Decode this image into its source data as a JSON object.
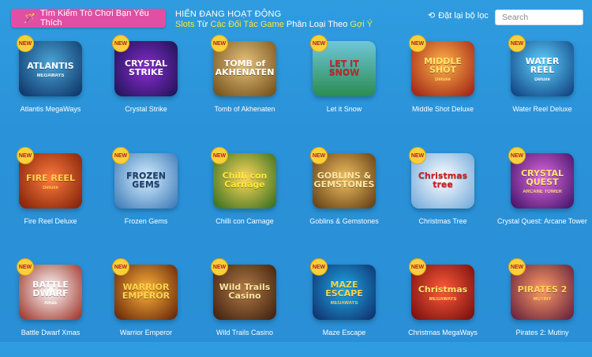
{
  "header": {
    "find_button_label": "Tìm Kiếm Trò Chơi Bạn Yêu Thích",
    "filter_line1": "HIỂN ĐANG HOẠT ĐỘNG",
    "filter_line2": {
      "slots": "Slots",
      "tu": "Từ",
      "partners": "Các Đối Tác Game",
      "sort_by": "Phân Loại Theo",
      "suggested": "Gợi Ý"
    },
    "reset_label": "Đặt lại bộ lọc",
    "search_placeholder": "Search"
  },
  "badge_label": "NEW",
  "games": [
    {
      "title": "Atlantis MegaWays",
      "logo": "ATLANTIS",
      "sub": "MEGAWAYS"
    },
    {
      "title": "Crystal Strike",
      "logo": "CRYSTAL STRIKE",
      "sub": ""
    },
    {
      "title": "Tomb of Akhenaten",
      "logo": "TOMB of AKHENATEN",
      "sub": ""
    },
    {
      "title": "Let it Snow",
      "logo": "LET IT SNOW",
      "sub": ""
    },
    {
      "title": "Middle Shot Deluxe",
      "logo": "MIDDLE SHOT",
      "sub": "Deluxe"
    },
    {
      "title": "Water Reel Deluxe",
      "logo": "WATER REEL",
      "sub": "Deluxe"
    },
    {
      "title": "Fire Reel Deluxe",
      "logo": "FIRE REEL",
      "sub": "Deluxe"
    },
    {
      "title": "Frozen Gems",
      "logo": "FROZEN GEMS",
      "sub": ""
    },
    {
      "title": "Chilli con Carnage",
      "logo": "Chilli con Carnage",
      "sub": ""
    },
    {
      "title": "Goblins & Gemstones",
      "logo": "GOBLINS & GEMSTONES",
      "sub": ""
    },
    {
      "title": "Christmas Tree",
      "logo": "Christmas tree",
      "sub": ""
    },
    {
      "title": "Crystal Quest: Arcane Tower",
      "logo": "CRYSTAL QUEST",
      "sub": "ARCANE TOWER"
    },
    {
      "title": "Battle Dwarf Xmas",
      "logo": "BATTLE DWARF",
      "sub": "Xmas"
    },
    {
      "title": "Warrior Emperor",
      "logo": "WARRIOR EMPEROR",
      "sub": ""
    },
    {
      "title": "Wild Trails Casino",
      "logo": "Wild Trails Casino",
      "sub": ""
    },
    {
      "title": "Maze Escape",
      "logo": "MAZE ESCAPE",
      "sub": "MEGAWAYS"
    },
    {
      "title": "Christmas MegaWays",
      "logo": "Christmas",
      "sub": "MEGAWAYS"
    },
    {
      "title": "Pirates 2: Mutiny",
      "logo": "PIRATES 2",
      "sub": "MUTINY"
    }
  ]
}
